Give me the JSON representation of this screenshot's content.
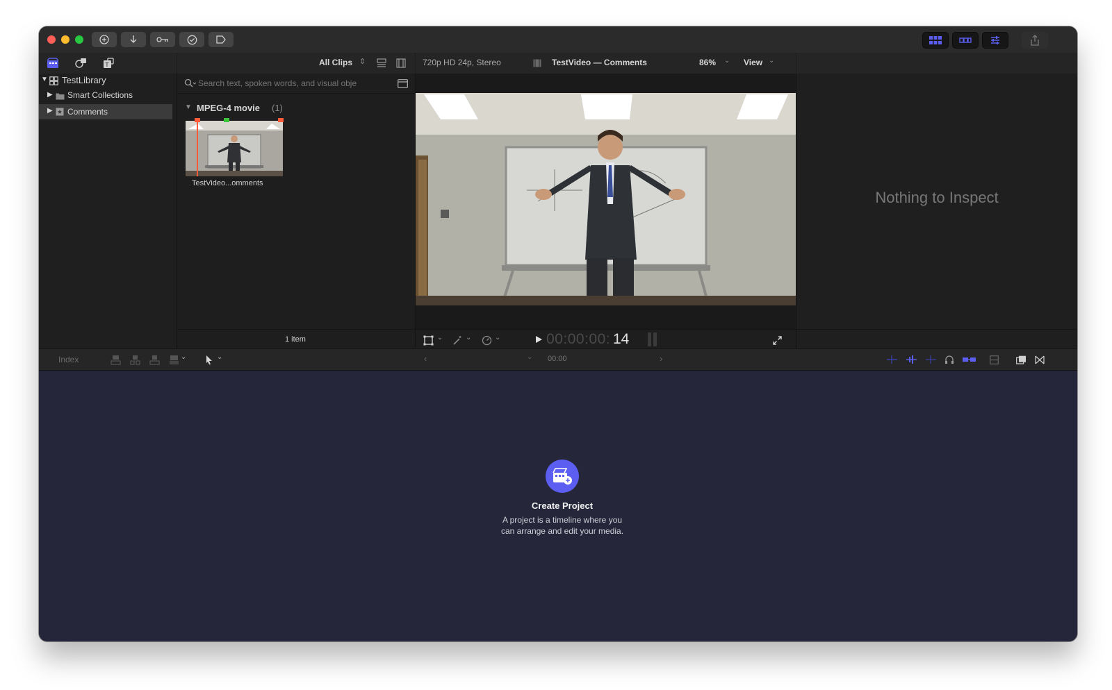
{
  "toolbar": {
    "buttons": [
      "import",
      "download",
      "keyword",
      "check",
      "share-clip"
    ]
  },
  "sidebar": {
    "library": "TestLibrary",
    "items": [
      {
        "label": "Smart Collections"
      },
      {
        "label": "Comments"
      }
    ]
  },
  "browser": {
    "filter": "All Clips",
    "search_placeholder": "Search text, spoken words, and visual obje",
    "group_label": "MPEG-4 movie",
    "group_count": "(1)",
    "clip_name": "TestVideo...omments",
    "footer": "1 item"
  },
  "viewer": {
    "format": "720p HD 24p, Stereo",
    "title": "TestVideo — Comments",
    "zoom": "86%",
    "view_label": "View",
    "timecode_dim": "00:00:00:",
    "timecode_frames": "14"
  },
  "inspector": {
    "empty_text": "Nothing to Inspect"
  },
  "timeline_bar": {
    "index_label": "Index",
    "timecode": "00:00"
  },
  "timeline": {
    "create_title": "Create Project",
    "create_desc_line1": "A project is a timeline where you",
    "create_desc_line2": "can arrange and edit your media."
  },
  "colors": {
    "accent": "#5b5ef0",
    "timeline_bg": "#26263a"
  }
}
